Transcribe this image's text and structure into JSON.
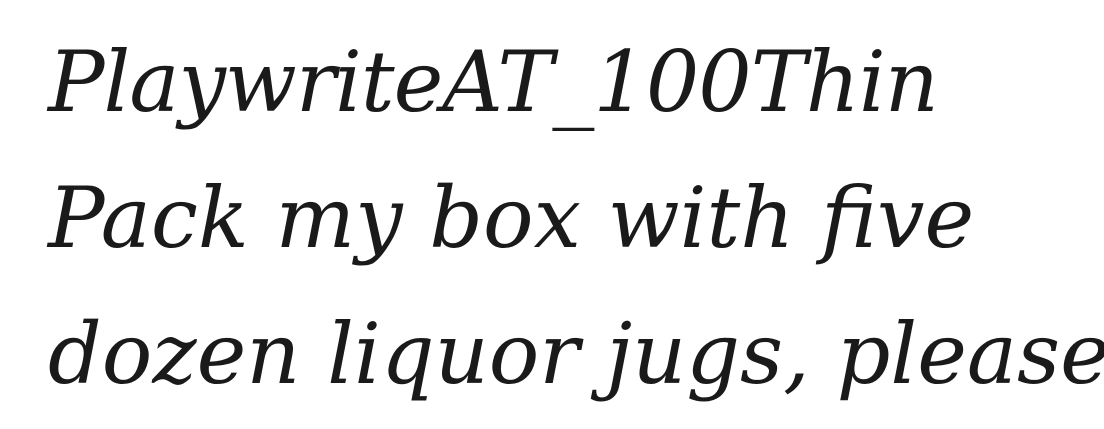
{
  "specimen": {
    "font_label": "PlaywriteAT_100Thin",
    "sample_lines": [
      "Pack my box with five",
      "dozen liquor jugs, please."
    ],
    "text_color": "#1a1a1a",
    "background_color": "#ffffff"
  }
}
